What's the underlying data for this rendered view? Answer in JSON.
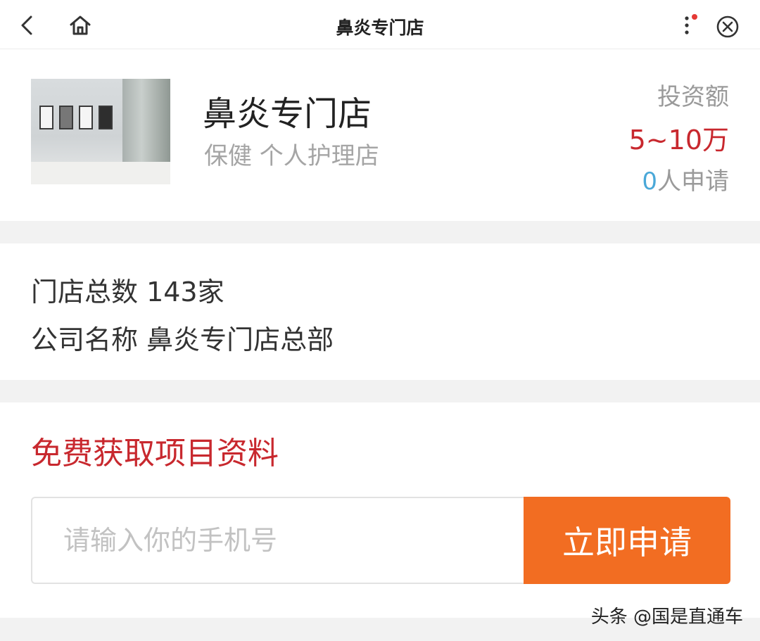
{
  "header": {
    "title": "鼻炎专门店",
    "back_icon": "chevron-left-icon",
    "home_icon": "home-icon",
    "more_icon": "more-vertical-icon",
    "close_icon": "close-circle-icon",
    "notification_dot_color": "#e53935"
  },
  "store": {
    "name": "鼻炎专门店",
    "category": "保健 个人护理店",
    "invest_label": "投资额",
    "invest_amount": "5~10万",
    "applicant_count": "0",
    "applicant_suffix": "人申请"
  },
  "info": {
    "store_count": "门店总数 143家",
    "company_name": "公司名称 鼻炎专门店总部"
  },
  "apply": {
    "title": "免费获取项目资料",
    "phone_placeholder": "请输入你的手机号",
    "phone_value": "",
    "button_label": "立即申请"
  },
  "watermark": "头条 @国是直通车",
  "colors": {
    "accent_red": "#c8282e",
    "button_orange": "#f26d22",
    "count_blue": "#4aa8d8"
  }
}
